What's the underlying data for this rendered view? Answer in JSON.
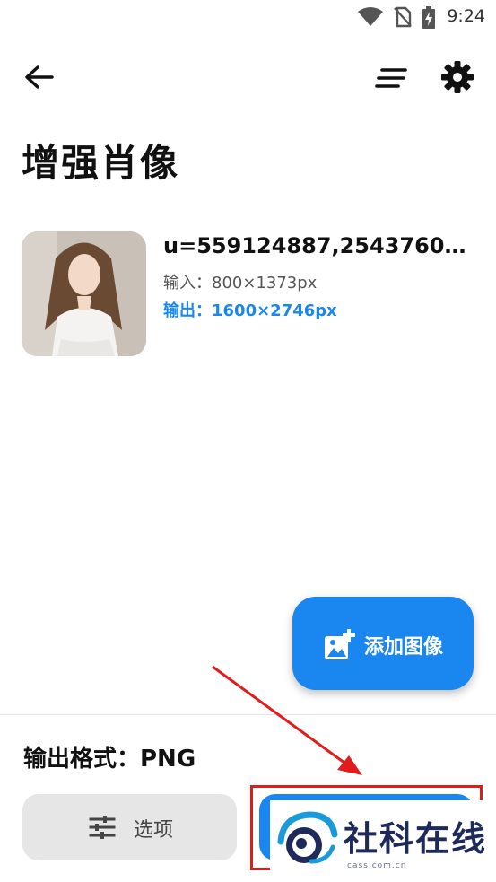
{
  "status_bar": {
    "time": "9:24"
  },
  "app_bar": {
    "back_icon": "arrow-left-icon",
    "sort_icon": "sort-lines-icon",
    "settings_icon": "gear-icon"
  },
  "page": {
    "title": "增强肖像"
  },
  "image_item": {
    "filename": "u=559124887,2543760…",
    "input_size": "输入：800×1373px",
    "output_size": "输出：1600×2746px"
  },
  "fab": {
    "label": "添加图像",
    "icon": "add-photo-icon"
  },
  "bottom_bar": {
    "output_format": "输出格式：PNG",
    "options_label": "选项",
    "options_icon": "tune-icon"
  },
  "watermark": {
    "text": "社科在线",
    "sub": "cass.com.cn"
  },
  "colors": {
    "accent": "#1a86f0",
    "annotation": "#e21b1b",
    "watermark": "#1e2a5a"
  }
}
